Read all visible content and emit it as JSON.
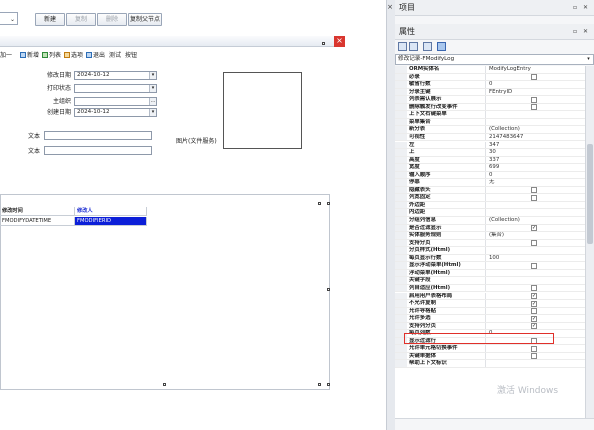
{
  "toolbar": {
    "combo_arrow": "⌄",
    "new_label": "新建",
    "copy_label": "复制",
    "delete_label": "删除",
    "copy_parent_label": "复制父节点"
  },
  "form": {
    "toolbar_items": [
      "新增",
      "列表",
      "选项",
      "退出",
      "测试",
      "按钮"
    ],
    "toolbar_prefix": "加一",
    "fields": [
      {
        "label": "修改日期",
        "value": "2024-10-12",
        "kind": "dropdown"
      },
      {
        "label": "打印状态",
        "value": "",
        "kind": "dropdown"
      },
      {
        "label": "主组织",
        "value": "",
        "kind": "lookup"
      },
      {
        "label": "创建日期",
        "value": "2024-10-12",
        "kind": "dropdown"
      }
    ],
    "text_labels": [
      "文本",
      "文本"
    ],
    "picture_label": "图片(文件服务)",
    "grid": {
      "headers": [
        "修改时间",
        "修改人"
      ],
      "row": [
        "FMODIFYDATETIME",
        "FMODIFIERID"
      ]
    }
  },
  "panels": {
    "project_title": "项目",
    "props_title": "属性",
    "title_buttons": "▫ ✕",
    "object_combo": "修改记录-FModifyLog"
  },
  "properties": [
    {
      "name": "ORM实体名",
      "value": "ModifyLogEntry",
      "cb": null
    },
    {
      "name": "必录",
      "value": "",
      "cb": false
    },
    {
      "name": "敏省行数",
      "value": "0",
      "cb": null
    },
    {
      "name": "分录主键",
      "value": "FEntryID",
      "cb": null
    },
    {
      "name": "列表需认展示",
      "value": "",
      "cb": false
    },
    {
      "name": "删除触发行改变事件",
      "value": "",
      "cb": false
    },
    {
      "name": "上下文右键菜单",
      "value": "",
      "cb": null
    },
    {
      "name": "菜单集合",
      "value": "",
      "cb": null
    },
    {
      "name": "新分表",
      "value": "(Collection)",
      "cb": null
    },
    {
      "name": "可视性",
      "value": "2147483647",
      "cb": null
    },
    {
      "name": "左",
      "value": "347",
      "cb": null
    },
    {
      "name": "上",
      "value": "30",
      "cb": null
    },
    {
      "name": "高度",
      "value": "337",
      "cb": null
    },
    {
      "name": "宽度",
      "value": "699",
      "cb": null
    },
    {
      "name": "输入顺序",
      "value": "0",
      "cb": null
    },
    {
      "name": "停靠",
      "value": "无",
      "cb": null
    },
    {
      "name": "隐藏表头",
      "value": "",
      "cb": false
    },
    {
      "name": "列宽固定",
      "value": "",
      "cb": false
    },
    {
      "name": "外边距",
      "value": "",
      "cb": null
    },
    {
      "name": "内边距",
      "value": "",
      "cb": null
    },
    {
      "name": "分组列信息",
      "value": "(Collection)",
      "cb": null
    },
    {
      "name": "是否过滤显示",
      "value": "",
      "cb": true
    },
    {
      "name": "实体服务规则",
      "value": "(集合)",
      "cb": null
    },
    {
      "name": "支持分页",
      "value": "",
      "cb": false
    },
    {
      "name": "分页样式(Html)",
      "value": "",
      "cb": null
    },
    {
      "name": "每页显示行数",
      "value": "100",
      "cb": null
    },
    {
      "name": "显示浮动菜单(Html)",
      "value": "",
      "cb": false
    },
    {
      "name": "浮动菜单(Html)",
      "value": "",
      "cb": null
    },
    {
      "name": "关键字段",
      "value": "",
      "cb": null
    },
    {
      "name": "列自适应(Html)",
      "value": "",
      "cb": false
    },
    {
      "name": "启用用户表格布局",
      "value": "",
      "cb": true
    },
    {
      "name": "不允许复制",
      "value": "",
      "cb": true
    },
    {
      "name": "允许导格贴",
      "value": "",
      "cb": false
    },
    {
      "name": "允许多选",
      "value": "",
      "cb": true
    },
    {
      "name": "支持列分页",
      "value": "",
      "cb": true
    },
    {
      "name": "每页列数",
      "value": "0",
      "cb": null
    },
    {
      "name": "显示过滤行",
      "value": "",
      "cb": false
    },
    {
      "name": "允许单元格切换事件",
      "value": "",
      "cb": false
    },
    {
      "name": "关键单据体",
      "value": "",
      "cb": false
    },
    {
      "name": "帮助上下文标识",
      "value": "",
      "cb": null
    }
  ],
  "watermark": "激活 Windows",
  "colors": {
    "highlight": "#0c1fd8",
    "close": "#d9362f",
    "redbox": "#e0302a"
  }
}
